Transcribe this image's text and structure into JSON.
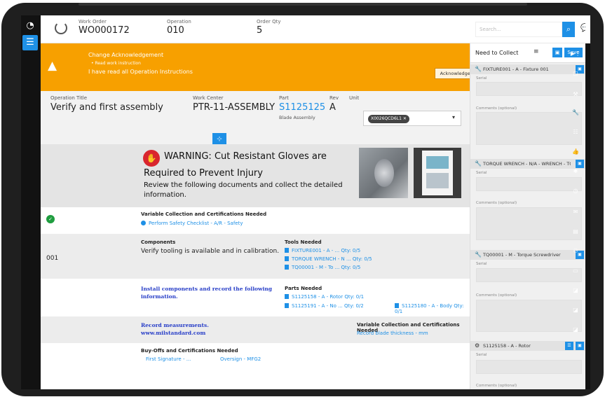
{
  "header": {
    "work_order_label": "Work Order",
    "work_order": "WO000172",
    "operation_label": "Operation",
    "operation": "010",
    "order_qty_label": "Order Qty",
    "order_qty": "5",
    "search_placeholder": "Search...",
    "search_icon": "search-icon",
    "chat_icon": "chat-icon"
  },
  "banner": {
    "title": "Change Acknowledgement",
    "bullet": "•  Read work instruction",
    "message": "I have read all Operation Instructions",
    "button": "Acknowledged?",
    "color": "#f7a000"
  },
  "operation": {
    "title_label": "Operation Title",
    "title": "Verify and first assembly",
    "work_center_label": "Work Center",
    "work_center": "PTR-11-ASSEMBLY",
    "part_label": "Part",
    "part": "S1125125",
    "part_desc": "Blade Assembly",
    "rev_label": "Rev",
    "rev": "A",
    "unit_label": "Unit",
    "unit_chip": "X0026QCD6L1"
  },
  "warning": {
    "line1": "WARNING: Cut Resistant Gloves are",
    "line2": "Required to Prevent Injury",
    "line3": "Review the following documents and collect the detailed",
    "line4": "information."
  },
  "steps": {
    "s1_head": "Variable Collection and Certifications Needed",
    "s1_link": "Perform Safety Checklist - A/R - Safety",
    "s2_num": "001",
    "s2_head": "Components",
    "s2_text": "Verify tooling is available and in calibration.",
    "tools_head": "Tools Needed",
    "tools": [
      "FIXTURE001 - A - ...  Qty: 0/5",
      "TORQUE WRENCH - N ...  Qty: 0/5",
      "TQ00001 - M - To ...  Qty: 0/5"
    ],
    "s3_text1": "Install components and record the following",
    "s3_text2": "information.",
    "parts_head": "Parts Needed",
    "parts": [
      "S1125158 - A - Rotor  Qty: 0/1",
      "S1125191 - A - No ...  Qty: 0/2",
      "S1125180 - A - Body  Qty: 0/1"
    ],
    "s4_text1": "Record measurements.",
    "s4_text2": "www.milstandard.com",
    "s4_head": "Variable Collection and Certifications Needed",
    "s4_link": "Record blade thickness - mm",
    "s5_head": "Buy-Offs and Certifications Needed",
    "s5_link1": "First Signature - ...",
    "s5_link2": "Oversign - MFG2"
  },
  "collect": {
    "title": "Need to Collect",
    "save": "Save",
    "serial_label": "Serial",
    "comments_label": "Comments (optional)",
    "items": [
      "FIXTURE001 - A - Fixture 001",
      "TORQUE WRENCH - N/A - WRENCH - TO...",
      "TQ00001 - M - Torque Screwdriver",
      "S1125158 - A - Rotor"
    ]
  },
  "colors": {
    "accent": "#1e90e6",
    "dark": "#121212",
    "success": "#1f9d3f",
    "danger": "#d9262e"
  }
}
